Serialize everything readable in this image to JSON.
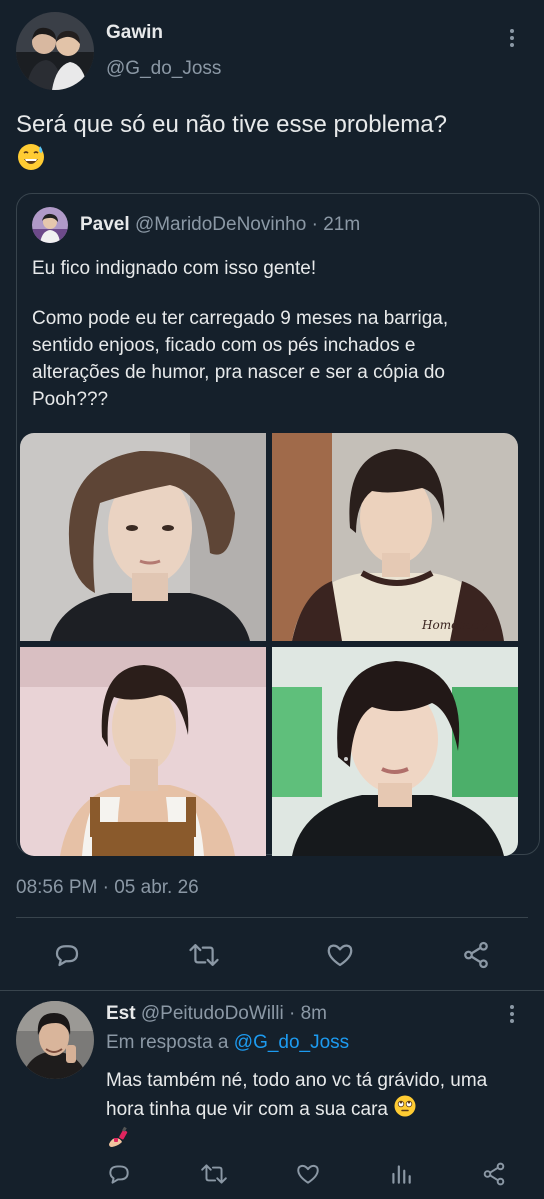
{
  "tweet": {
    "author_name": "Gawin",
    "author_handle": "@G_do_Joss",
    "text": "Será que só eu não tive esse problema?",
    "emoji_icon": "sweat-smile-emoji",
    "timestamp": "08:56 PM · 05 abr. 26"
  },
  "quote": {
    "author_name": "Pavel",
    "author_handle": "@MaridoDeNovinho",
    "time": "· 21m",
    "line1": "Eu fico indignado com isso gente!",
    "paragraph": "Como pode eu ter carregado 9 meses na barriga, sentido enjoos, ficado com os pés inchados e alterações de humor, pra nascer e ser a cópia do Pooh???",
    "shirt_logo": "Homebody"
  },
  "actions": [
    "reply-icon",
    "retweet-icon",
    "like-icon",
    "share-icon"
  ],
  "reply": {
    "author_name": "Est",
    "author_handle": "@PeitudoDoWilli",
    "time": "· 8m",
    "reply_prefix": "Em resposta a",
    "reply_to": "@G_do_Joss",
    "text": "Mas também né, todo ano vc tá grávido, uma hora tinha que vir com a sua cara",
    "emojis": [
      "eye-roll-emoji",
      "nail-polish-emoji"
    ]
  },
  "reply_actions": [
    "reply-icon",
    "retweet-icon",
    "like-icon",
    "views-icon",
    "share-icon"
  ],
  "colors": {
    "background": "#15202b",
    "text": "#e7e9ea",
    "muted": "#8b98a5",
    "link": "#1d9bf0",
    "divider": "#38444d"
  }
}
